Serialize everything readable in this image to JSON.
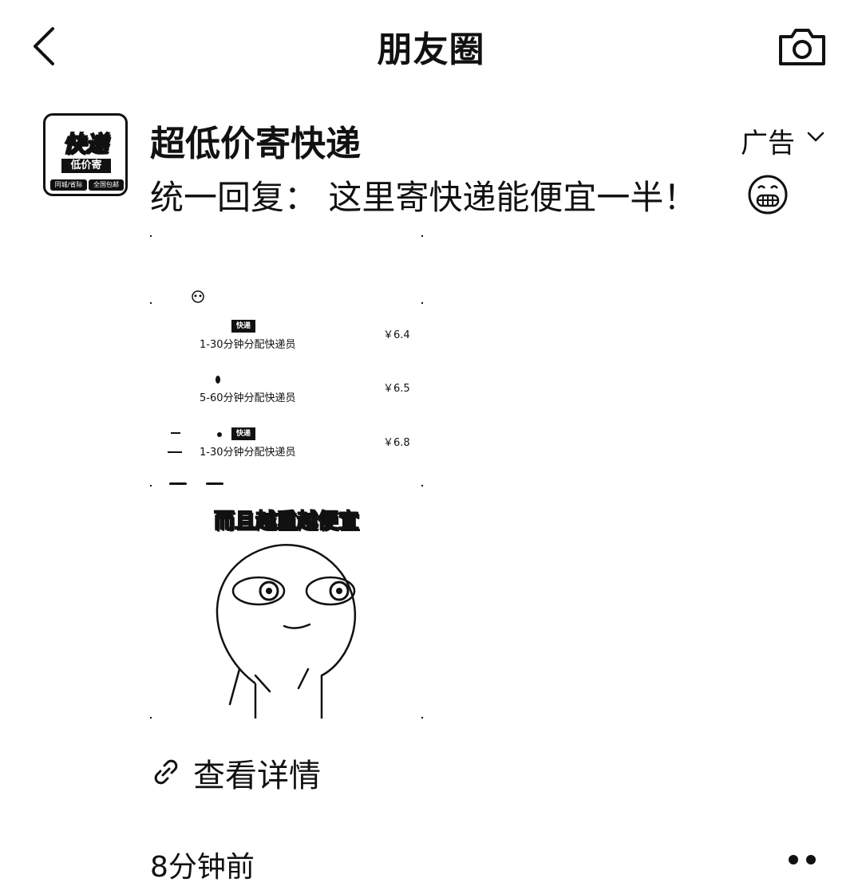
{
  "header": {
    "title": "朋友圈",
    "back_icon": "chevron-left-icon",
    "camera_icon": "camera-icon"
  },
  "post": {
    "avatar": {
      "big_text": "快递",
      "mid_text": "低价寄",
      "small_left": "同城/省际",
      "small_right": "全国包邮"
    },
    "sender": "超低价寄快递",
    "ad_label": "广告",
    "text": "统一回复： 这里寄快递能便宜一半！",
    "emoji": "grinning-face-icon",
    "image": {
      "rows": [
        {
          "badge": "快递",
          "desc": "1-30分钟分配快递员",
          "price": "￥6.4"
        },
        {
          "badge": "",
          "desc": "5-60分钟分配快递员",
          "price": "￥6.5"
        },
        {
          "badge": "快递",
          "desc": "1-30分钟分配快递员",
          "price": "￥6.8"
        }
      ],
      "caption": "而且越重越便宜"
    },
    "link_text": "查看详情",
    "timestamp": "8分钟前",
    "more_icon": "more-dots-icon"
  }
}
